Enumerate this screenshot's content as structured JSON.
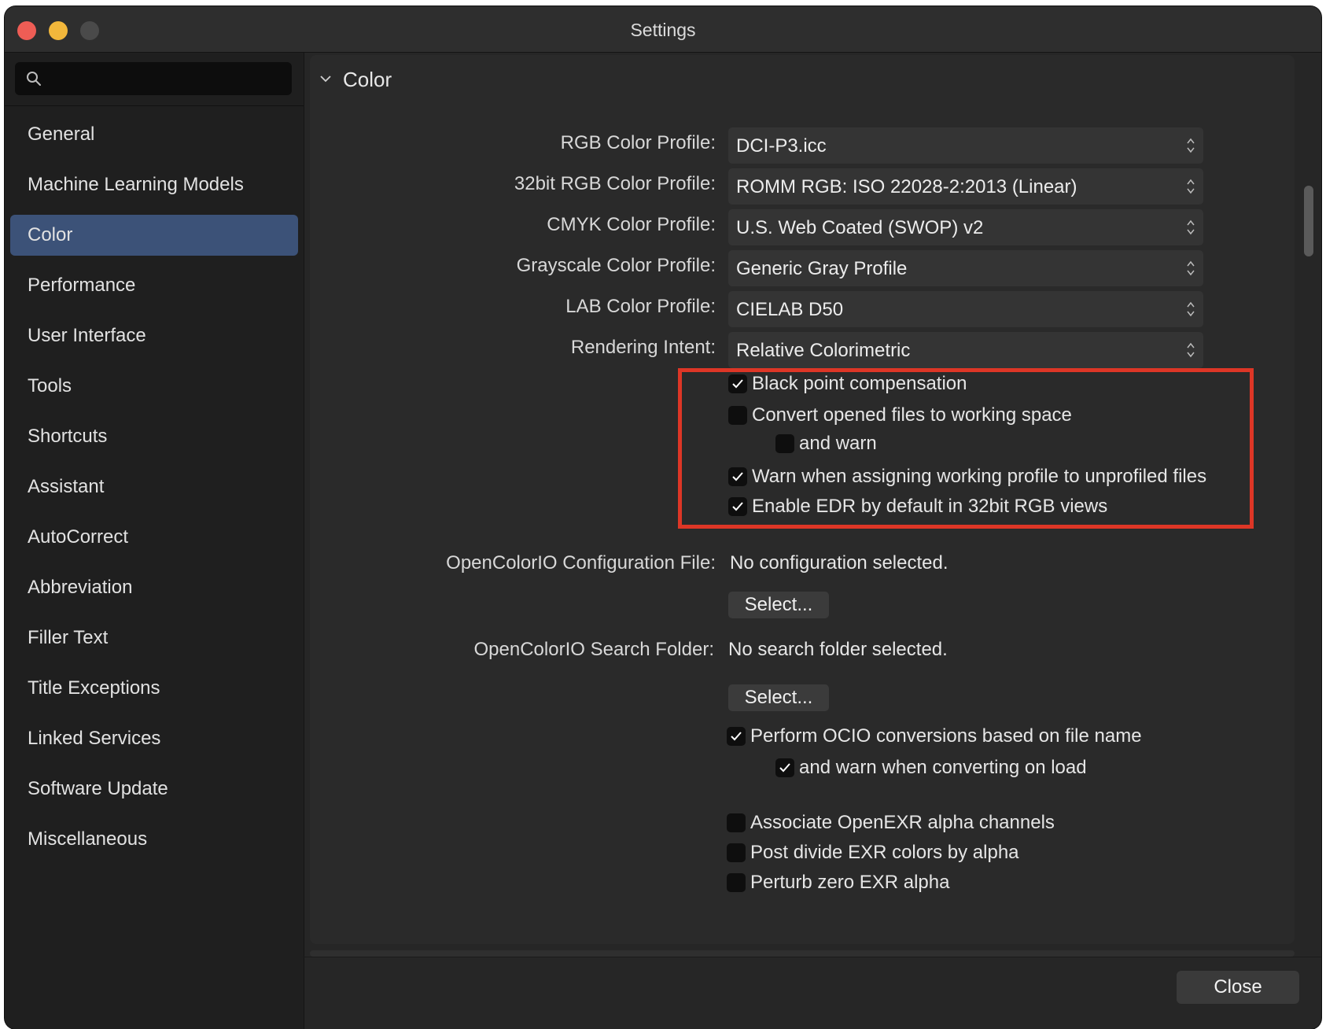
{
  "window": {
    "title": "Settings"
  },
  "search": {
    "placeholder": ""
  },
  "sidebar": {
    "items": [
      {
        "label": "General"
      },
      {
        "label": "Machine Learning Models"
      },
      {
        "label": "Color",
        "active": true
      },
      {
        "label": "Performance"
      },
      {
        "label": "User Interface"
      },
      {
        "label": "Tools"
      },
      {
        "label": "Shortcuts"
      },
      {
        "label": "Assistant"
      },
      {
        "label": "AutoCorrect"
      },
      {
        "label": "Abbreviation"
      },
      {
        "label": "Filler Text"
      },
      {
        "label": "Title Exceptions"
      },
      {
        "label": "Linked Services"
      },
      {
        "label": "Software Update"
      },
      {
        "label": "Miscellaneous"
      }
    ]
  },
  "section": {
    "title": "Color"
  },
  "profiles": [
    {
      "label": "RGB Color Profile:",
      "value": "DCI-P3.icc"
    },
    {
      "label": "32bit RGB Color Profile:",
      "value": "ROMM RGB: ISO 22028-2:2013 (Linear)"
    },
    {
      "label": "CMYK Color Profile:",
      "value": "U.S. Web Coated (SWOP) v2"
    },
    {
      "label": "Grayscale Color Profile:",
      "value": "Generic Gray Profile"
    },
    {
      "label": "LAB Color Profile:",
      "value": "CIELAB D50"
    },
    {
      "label": "Rendering Intent:",
      "value": "Relative Colorimetric"
    }
  ],
  "options": [
    {
      "label": "Black point compensation",
      "checked": true
    },
    {
      "label": "Convert opened files to working space",
      "checked": false
    },
    {
      "label": "and warn",
      "checked": false
    },
    {
      "label": "Warn when assigning working profile to unprofiled files",
      "checked": true
    },
    {
      "label": "Enable EDR by default in 32bit RGB views",
      "checked": true
    }
  ],
  "ocio": {
    "config_label": "OpenColorIO Configuration File:",
    "config_value": "No configuration selected.",
    "config_button": "Select...",
    "folder_label": "OpenColorIO Search Folder:",
    "folder_value": "No search folder selected.",
    "folder_button": "Select...",
    "options": [
      {
        "label": "Perform OCIO conversions based on file name",
        "checked": true
      },
      {
        "label": "and warn when converting on load",
        "checked": true
      }
    ]
  },
  "exr": {
    "options": [
      {
        "label": "Associate OpenEXR alpha channels",
        "checked": false
      },
      {
        "label": "Post divide EXR colors by alpha",
        "checked": false
      },
      {
        "label": "Perturb zero EXR alpha",
        "checked": false
      }
    ]
  },
  "footer": {
    "close_label": "Close"
  },
  "colors": {
    "accent": "#3c5278",
    "highlight": "#dd3626",
    "background": "#262626"
  }
}
